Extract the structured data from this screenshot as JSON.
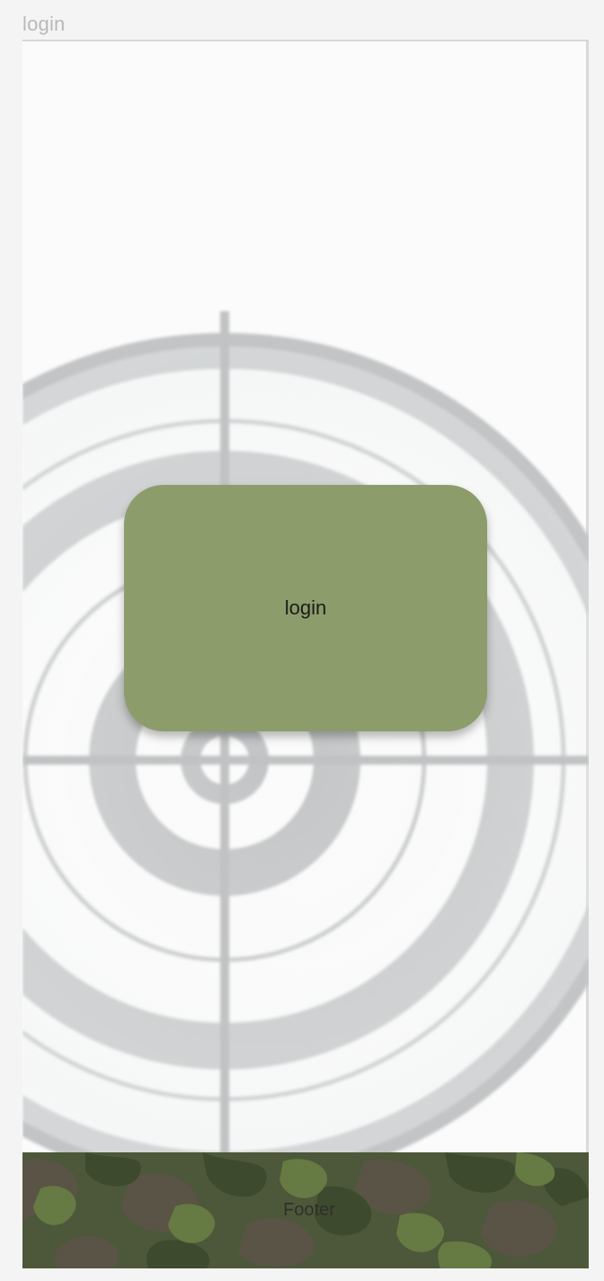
{
  "window": {
    "title": "login"
  },
  "main": {
    "login_button_label": "login",
    "background_icon": "crosshair-target-icon"
  },
  "footer": {
    "label": "Footer",
    "pattern": "camouflage"
  },
  "colors": {
    "page_background": "#f4f4f4",
    "frame_background": "#fbfbfb",
    "login_button": "#8c9c6b",
    "target_rings": "#c2c4c5",
    "camo_dark": "#3f4a30",
    "camo_mid": "#56683c",
    "camo_brown": "#5a5446"
  }
}
